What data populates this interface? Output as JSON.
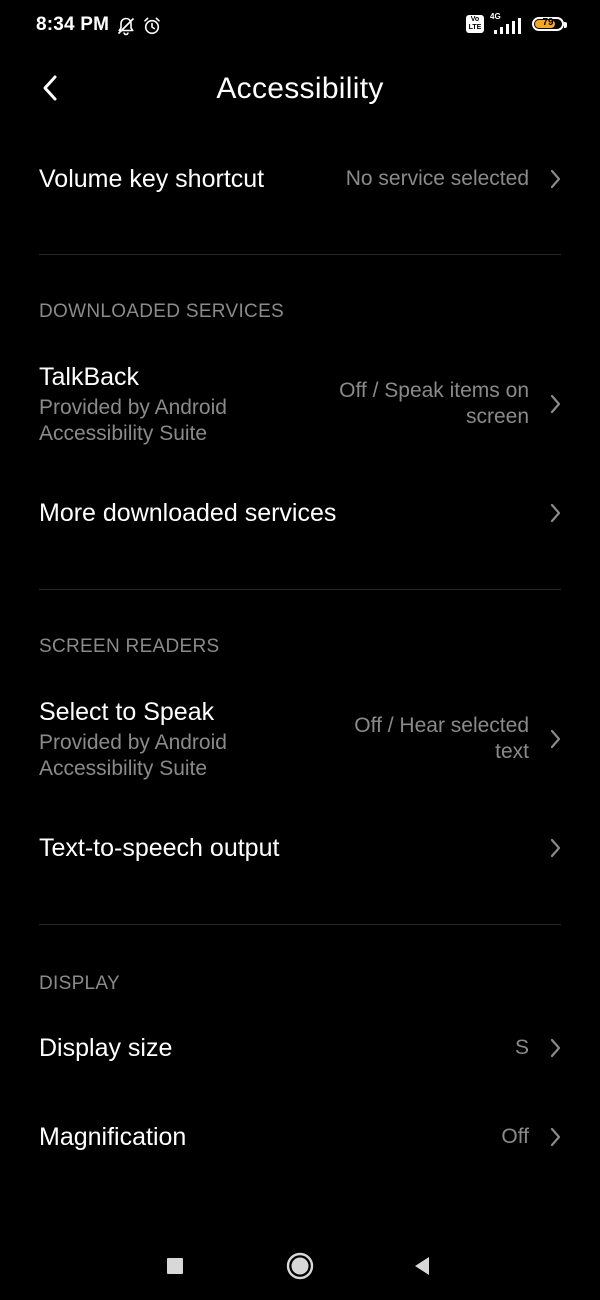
{
  "status_bar": {
    "time": "8:34 PM",
    "left_icons": [
      "notifications-muted-icon",
      "alarm-icon"
    ],
    "volte": "Vo LTE",
    "network": "4G",
    "battery_level": "79",
    "battery_percent": 79,
    "battery_color": "#f5a623"
  },
  "header": {
    "title": "Accessibility",
    "back_icon": "back-arrow-icon"
  },
  "items": {
    "volume_key": {
      "title": "Volume key shortcut",
      "value": "No service selected"
    },
    "talkback": {
      "title": "TalkBack",
      "subtitle": "Provided by Android Accessibility Suite",
      "value": "Off / Speak items on screen"
    },
    "more_downloaded": {
      "title": "More downloaded services"
    },
    "select_to_speak": {
      "title": "Select to Speak",
      "subtitle": "Provided by Android Accessibility Suite",
      "value": "Off / Hear selected text"
    },
    "tts_output": {
      "title": "Text-to-speech output"
    },
    "display_size": {
      "title": "Display size",
      "value": "S"
    },
    "magnification": {
      "title": "Magnification",
      "value": "Off"
    }
  },
  "sections": {
    "downloaded_services": "DOWNLOADED SERVICES",
    "screen_readers": "SCREEN READERS",
    "display": "DISPLAY"
  },
  "nav_bar": {
    "recents_icon": "square-recents-icon",
    "home_icon": "circle-home-icon",
    "back_icon": "triangle-back-icon"
  },
  "colors": {
    "background": "#000000",
    "primary_text": "#ffffff",
    "secondary_text": "#8a8a8a",
    "divider": "#262626"
  }
}
